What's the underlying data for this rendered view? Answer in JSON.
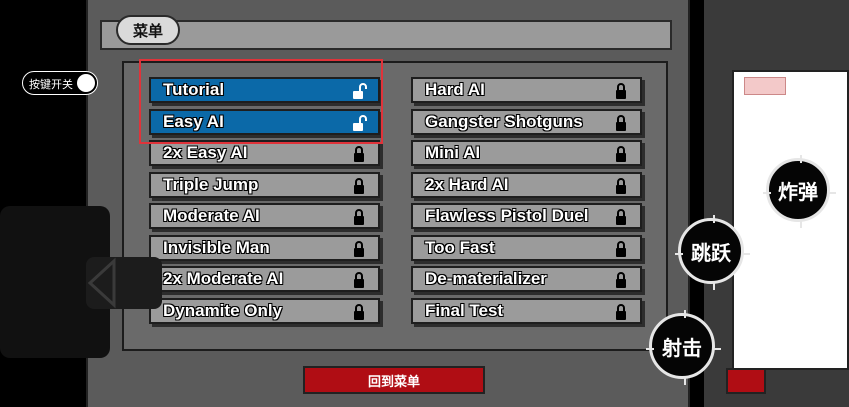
{
  "header": {
    "menu_label": "菜单"
  },
  "toggle": {
    "label": "按键开关",
    "state": "on"
  },
  "levels": {
    "left": [
      {
        "name": "Tutorial",
        "locked": false,
        "selected": true
      },
      {
        "name": "Easy AI",
        "locked": false,
        "selected": true
      },
      {
        "name": "2x Easy AI",
        "locked": true
      },
      {
        "name": "Triple Jump",
        "locked": true
      },
      {
        "name": "Moderate AI",
        "locked": true
      },
      {
        "name": "Invisible Man",
        "locked": true
      },
      {
        "name": "2x Moderate AI",
        "locked": true
      },
      {
        "name": "Dynamite Only",
        "locked": true
      }
    ],
    "right": [
      {
        "name": "Hard AI",
        "locked": true
      },
      {
        "name": "Gangster Shotguns",
        "locked": true
      },
      {
        "name": "Mini AI",
        "locked": true
      },
      {
        "name": "2x Hard AI",
        "locked": true
      },
      {
        "name": "Flawless Pistol Duel",
        "locked": true
      },
      {
        "name": "Too Fast",
        "locked": true
      },
      {
        "name": "De-materializer",
        "locked": true
      },
      {
        "name": "Final Test",
        "locked": true
      }
    ]
  },
  "footer": {
    "back_label": "回到菜单"
  },
  "controls": {
    "jump": "跳跃",
    "bomb": "炸弹",
    "shoot": "射击"
  },
  "icons": {
    "locked": "padlock-closed-icon",
    "unlocked": "padlock-open-icon",
    "left": "left-arrow-icon"
  },
  "colors": {
    "unlocked_bg": "#0b69a8",
    "locked_bg": "#9b9b9b",
    "highlight": "#e0333a",
    "back_button": "#b00d14"
  }
}
